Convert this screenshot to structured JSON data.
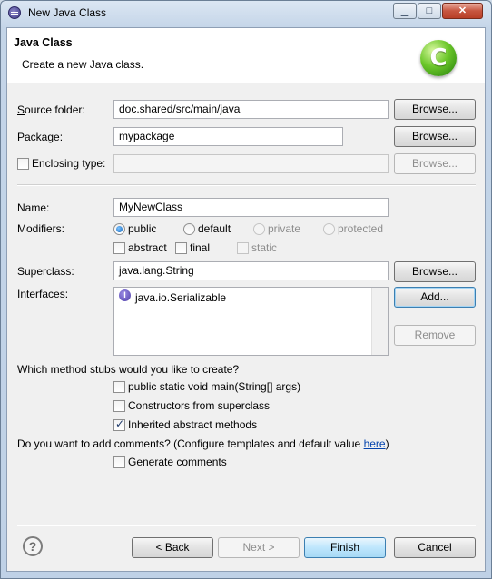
{
  "window": {
    "title": "New Java Class",
    "controls": {
      "minimize": "▁",
      "maximize": "□",
      "close": "✕"
    }
  },
  "banner": {
    "title": "Java Class",
    "description": "Create a new Java class.",
    "logo_letter": "C"
  },
  "source_folder": {
    "label": "Source folder:",
    "value": "doc.shared/src/main/java",
    "browse": "Browse..."
  },
  "package": {
    "label": "Package:",
    "value": "mypackage",
    "browse": "Browse..."
  },
  "enclosing_type": {
    "label": "Enclosing type:",
    "value": "",
    "checked": false,
    "browse": "Browse..."
  },
  "name": {
    "label": "Name:",
    "value": "MyNewClass"
  },
  "modifiers": {
    "label": "Modifiers:",
    "access": [
      "public",
      "default",
      "private",
      "protected"
    ],
    "selected": "public",
    "abstract": "abstract",
    "final": "final",
    "static": "static"
  },
  "superclass": {
    "label": "Superclass:",
    "value": "java.lang.String",
    "browse": "Browse..."
  },
  "interfaces": {
    "label": "Interfaces:",
    "items": [
      "java.io.Serializable"
    ],
    "icon_letter": "I",
    "add": "Add...",
    "remove": "Remove"
  },
  "method_stubs": {
    "question": "Which method stubs would you like to create?",
    "main": {
      "label": "public static void main(String[] args)",
      "checked": false
    },
    "constructors": {
      "label": "Constructors from superclass",
      "checked": false
    },
    "inherited": {
      "label": "Inherited abstract methods",
      "checked": true
    }
  },
  "comments": {
    "question": "Do you want to add comments? (Configure templates and default value ",
    "link": "here",
    "closing": ")",
    "generate": {
      "label": "Generate comments",
      "checked": false
    }
  },
  "footer": {
    "help_icon": "?",
    "back": "< Back",
    "next": "Next >",
    "finish": "Finish",
    "cancel": "Cancel"
  },
  "colors": {
    "accent": "#3c7fb1",
    "link": "#0645ad",
    "logo_green": "#6cc72a"
  }
}
